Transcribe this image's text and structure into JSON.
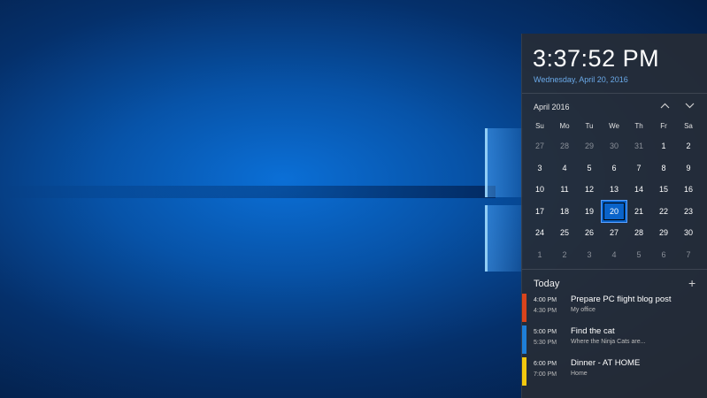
{
  "clock": {
    "time": "3:37:52 PM",
    "date": "Wednesday, April 20, 2016"
  },
  "calendar": {
    "month_label": "April 2016",
    "prev_icon": "chevron-up-icon",
    "next_icon": "chevron-down-icon",
    "weekdays": [
      "Su",
      "Mo",
      "Tu",
      "We",
      "Th",
      "Fr",
      "Sa"
    ],
    "weeks": [
      [
        "27",
        "28",
        "29",
        "30",
        "31",
        "1",
        "2"
      ],
      [
        "3",
        "4",
        "5",
        "6",
        "7",
        "8",
        "9"
      ],
      [
        "10",
        "11",
        "12",
        "13",
        "14",
        "15",
        "16"
      ],
      [
        "17",
        "18",
        "19",
        "20",
        "21",
        "22",
        "23"
      ],
      [
        "24",
        "25",
        "26",
        "27",
        "28",
        "29",
        "30"
      ],
      [
        "1",
        "2",
        "3",
        "4",
        "5",
        "6",
        "7"
      ]
    ],
    "selected": "20"
  },
  "agenda": {
    "heading": "Today",
    "add_icon": "plus-icon",
    "add_label": "+",
    "events": [
      {
        "start": "4:00 PM",
        "end": "4:30 PM",
        "title": "Prepare PC flight blog post",
        "location": "My office",
        "color": "#d9441c"
      },
      {
        "start": "5:00 PM",
        "end": "5:30 PM",
        "title": "Find the cat",
        "location": "Where the Ninja Cats are...",
        "color": "#1e7fd8"
      },
      {
        "start": "6:00 PM",
        "end": "7:00 PM",
        "title": "Dinner - AT HOME",
        "location": "Home",
        "color": "#f2c80f"
      }
    ]
  }
}
